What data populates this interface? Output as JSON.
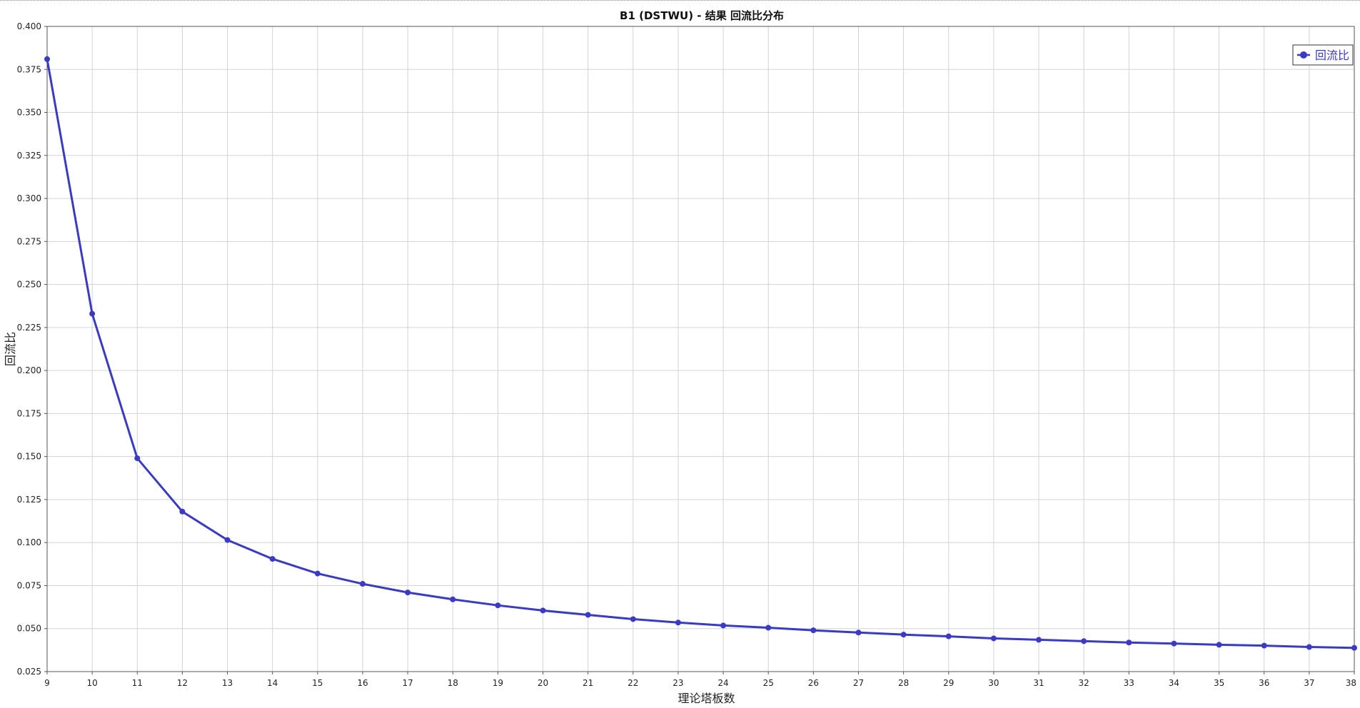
{
  "chart_data": {
    "type": "line",
    "title": "B1 (DSTWU) - 结果 回流比分布",
    "xlabel": "理论塔板数",
    "ylabel": "回流比",
    "x": [
      9,
      10,
      11,
      12,
      13,
      14,
      15,
      16,
      17,
      18,
      19,
      20,
      21,
      22,
      23,
      24,
      25,
      26,
      27,
      28,
      29,
      30,
      31,
      32,
      33,
      34,
      35,
      36,
      37,
      38
    ],
    "series": [
      {
        "name": "回流比",
        "values": [
          0.381,
          0.233,
          0.149,
          0.118,
          0.1015,
          0.0905,
          0.082,
          0.076,
          0.071,
          0.067,
          0.0635,
          0.0605,
          0.058,
          0.0555,
          0.0535,
          0.0518,
          0.0505,
          0.049,
          0.0477,
          0.0465,
          0.0455,
          0.0443,
          0.0435,
          0.0427,
          0.0419,
          0.0413,
          0.0406,
          0.0401,
          0.0393,
          0.0388
        ]
      }
    ],
    "xlim": [
      9,
      38
    ],
    "ylim": [
      0.025,
      0.4
    ],
    "yticks": [
      "0.025",
      "0.050",
      "0.075",
      "0.100",
      "0.125",
      "0.150",
      "0.175",
      "0.200",
      "0.225",
      "0.250",
      "0.275",
      "0.300",
      "0.325",
      "0.350",
      "0.375",
      "0.400"
    ],
    "xticks": [
      "9",
      "10",
      "11",
      "12",
      "13",
      "14",
      "15",
      "16",
      "17",
      "18",
      "19",
      "20",
      "21",
      "22",
      "23",
      "24",
      "25",
      "26",
      "27",
      "28",
      "29",
      "30",
      "31",
      "32",
      "33",
      "34",
      "35",
      "36",
      "37",
      "38"
    ],
    "grid": true,
    "legend_position": "top-right",
    "colors": {
      "series": "#3a3ac2",
      "grid": "#d3d3d3",
      "axis": "#555555"
    }
  }
}
